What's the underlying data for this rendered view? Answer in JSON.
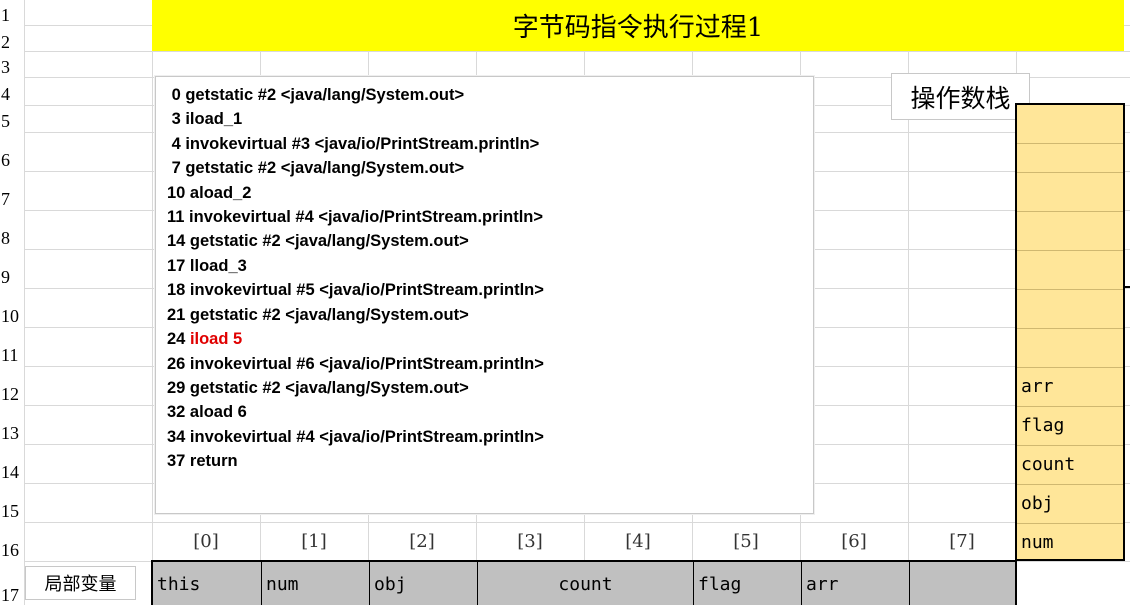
{
  "title": "字节码指令执行过程1",
  "row_numbers": [
    "1",
    "2",
    "3",
    "4",
    "5",
    "6",
    "7",
    "8",
    "9",
    "10",
    "11",
    "12",
    "13",
    "14",
    "15",
    "16",
    "17"
  ],
  "code": {
    "lines": [
      {
        "prefix": " 0 getstatic #2 <java/lang/System.out>",
        "highlight": ""
      },
      {
        "prefix": " 3 iload_1",
        "highlight": ""
      },
      {
        "prefix": " 4 invokevirtual #3 <java/io/PrintStream.println>",
        "highlight": ""
      },
      {
        "prefix": " 7 getstatic #2 <java/lang/System.out>",
        "highlight": ""
      },
      {
        "prefix": "10 aload_2",
        "highlight": ""
      },
      {
        "prefix": "11 invokevirtual #4 <java/io/PrintStream.println>",
        "highlight": ""
      },
      {
        "prefix": "14 getstatic #2 <java/lang/System.out>",
        "highlight": ""
      },
      {
        "prefix": "17 lload_3",
        "highlight": ""
      },
      {
        "prefix": "18 invokevirtual #5 <java/io/PrintStream.println>",
        "highlight": ""
      },
      {
        "prefix": "21 getstatic #2 <java/lang/System.out>",
        "highlight": ""
      },
      {
        "prefix": "24 ",
        "highlight": "iload 5"
      },
      {
        "prefix": "26 invokevirtual #6 <java/io/PrintStream.println>",
        "highlight": ""
      },
      {
        "prefix": "29 getstatic #2 <java/lang/System.out>",
        "highlight": ""
      },
      {
        "prefix": "32 aload 6",
        "highlight": ""
      },
      {
        "prefix": "34 invokevirtual #4 <java/io/PrintStream.println>",
        "highlight": ""
      },
      {
        "prefix": "37 return",
        "highlight": ""
      }
    ]
  },
  "operand_stack": {
    "label": "操作数栈",
    "cells": [
      "",
      "",
      "",
      "",
      "",
      "",
      "",
      "arr",
      "flag",
      "count",
      "obj",
      "num"
    ]
  },
  "local_vars": {
    "label": "局部变量",
    "indices": [
      "[0]",
      "[1]",
      "[2]",
      "[3]",
      "[4]",
      "[5]",
      "[6]",
      "[7]"
    ],
    "cells": [
      "this",
      "num",
      "obj",
      "count",
      "flag",
      "arr",
      ""
    ]
  },
  "colors": {
    "title_band": "#ffff00",
    "stack_fill": "#ffe699",
    "local_fill": "#c0c0c0",
    "highlight": "#e00000"
  }
}
